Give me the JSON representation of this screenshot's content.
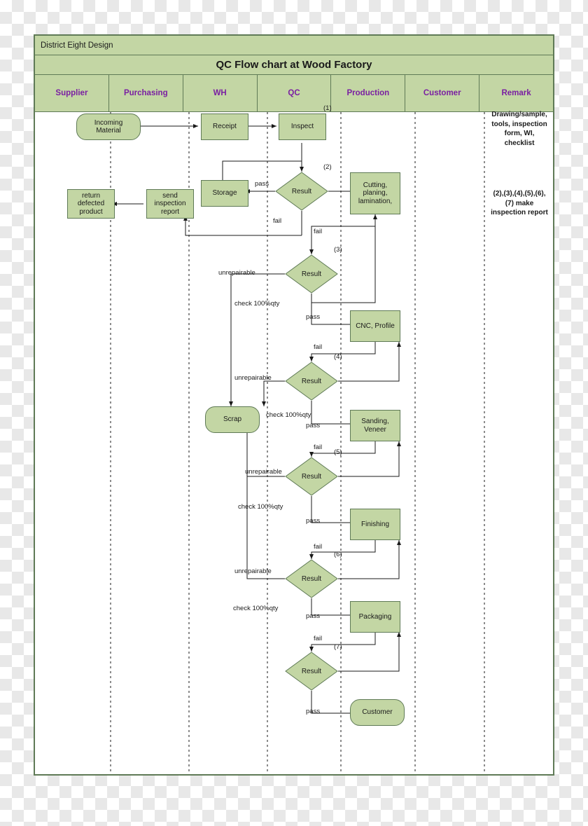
{
  "header": {
    "company": "District  Eight Design",
    "title": "QC Flow chart at Wood Factory",
    "columns": [
      {
        "label": "Supplier"
      },
      {
        "label": "Purchasing"
      },
      {
        "label": "WH"
      },
      {
        "label": "QC"
      },
      {
        "label": "Production"
      },
      {
        "label": "Customer"
      },
      {
        "label": "Remark"
      }
    ]
  },
  "nodes": {
    "incoming_material": "Incoming\nMaterial",
    "receipt": "Receipt",
    "inspect": "Inspect",
    "storage": "Storage",
    "cutting": "Cutting,\nplaning,\nlamination,",
    "return_defected": "return\ndefected\nproduct",
    "send_inspection_report": "send\ninspection\nreport",
    "cnc_profile": "CNC, Profile",
    "sanding_veneer": "Sanding,\nVeneer",
    "finishing": "Finishing",
    "packaging": "Packaging",
    "scrap": "Scrap",
    "customer": "Customer",
    "result1": "Result",
    "result2": "Result",
    "result3": "Result",
    "result4": "Result",
    "result5": "Result",
    "result6": "Result"
  },
  "step_numbers": {
    "s1": "(1)",
    "s2": "(2)",
    "s3": "(3)",
    "s4": "(4)",
    "s5": "(5)",
    "s6": "(6)",
    "s7": "(7)"
  },
  "edge_labels": {
    "pass_storage": "pass",
    "fail_1": "fail",
    "fail_2": "fail",
    "unrepairable_3": "unrepairable",
    "check_3": "check 100%qty",
    "pass_3": "pass",
    "fail_3": "fail",
    "unrepairable_4": "unrepairable",
    "check_4": "check 100%qty",
    "pass_4": "pass",
    "fail_4": "fail",
    "unrepairable_5": "unrepairable",
    "check_5": "check 100%qty",
    "pass_5": "pass",
    "fail_5": "fail",
    "unrepairable_6": "unrepairable",
    "check_6": "check 100%qty",
    "pass_6": "pass",
    "fail_6": "fail",
    "pass_7": "pass"
  },
  "remarks": {
    "first": "Drawing/sample,\ntools, inspection\nform, WI,\nchecklist",
    "second": "(2),(3),(4),(5),(6),\n(7) make\ninspection report"
  },
  "colors": {
    "node_fill": "#c3d6a4",
    "node_stroke": "#5f7a56",
    "header_text": "#7a1fa2",
    "line": "#1a1a1a"
  }
}
